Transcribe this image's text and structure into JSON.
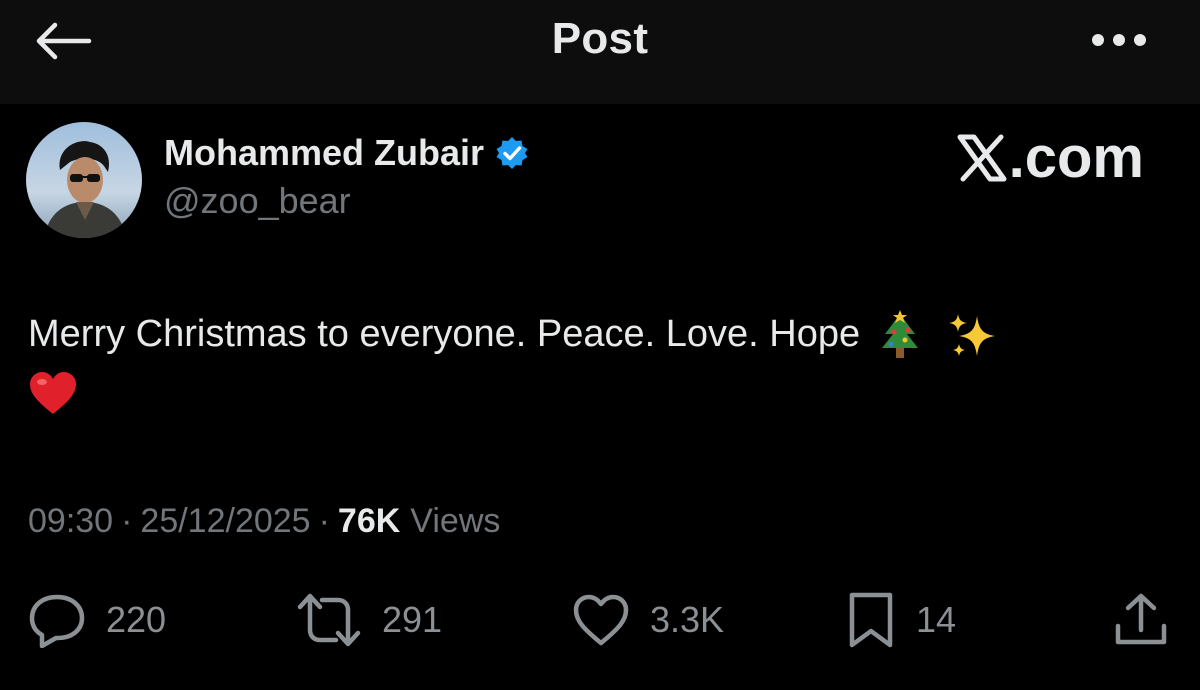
{
  "header": {
    "title": "Post",
    "back_icon": "back-arrow-icon",
    "more_icon": "more-dots-icon"
  },
  "author": {
    "name": "Mohammed Zubair",
    "handle": "@zoo_bear",
    "verified": true,
    "verified_color": "#1d9bf0"
  },
  "brand": {
    "label": ".com"
  },
  "post": {
    "text": "Merry Christmas to everyone. Peace. Love. Hope",
    "emojis": [
      "christmas-tree-icon",
      "sparkles-icon",
      "red-heart-icon"
    ]
  },
  "meta": {
    "time": "09:30",
    "separator": "·",
    "date": "25/12/2025",
    "views_count": "76K",
    "views_label": "Views"
  },
  "actions": {
    "replies": "220",
    "reposts": "291",
    "likes": "3.3K",
    "bookmarks": "14"
  },
  "colors": {
    "background": "#000000",
    "topbar": "#0d0d0d",
    "text_primary": "#e7e9ea",
    "text_secondary": "#71767b",
    "accent": "#1d9bf0"
  }
}
